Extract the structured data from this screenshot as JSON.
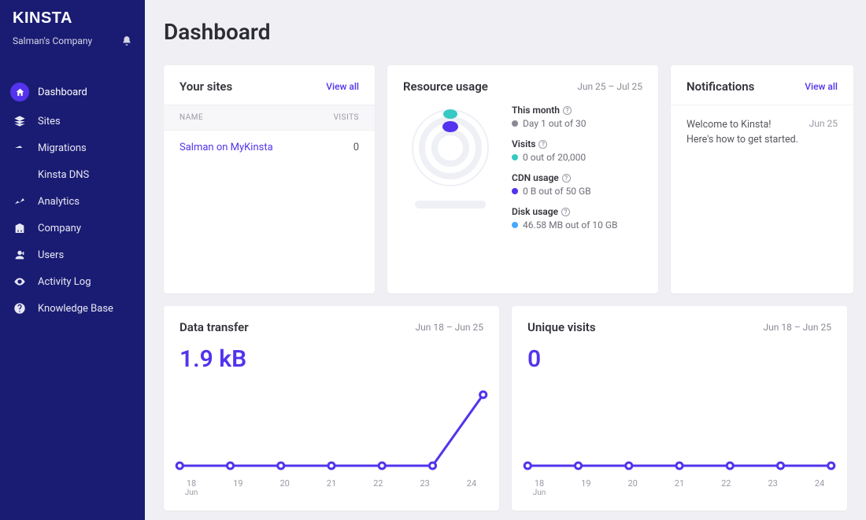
{
  "brand": "KINSTA",
  "company_name": "Salman's Company",
  "page_title": "Dashboard",
  "viewall_label": "View all",
  "nav": [
    {
      "label": "Dashboard"
    },
    {
      "label": "Sites"
    },
    {
      "label": "Migrations"
    },
    {
      "label": "Kinsta DNS"
    },
    {
      "label": "Analytics"
    },
    {
      "label": "Company"
    },
    {
      "label": "Users"
    },
    {
      "label": "Activity Log"
    },
    {
      "label": "Knowledge Base"
    }
  ],
  "sites": {
    "title": "Your sites",
    "col_name": "NAME",
    "col_visits": "VISITS",
    "rows": [
      {
        "name": "Salman on MyKinsta",
        "visits": "0"
      }
    ]
  },
  "usage": {
    "title": "Resource usage",
    "range": "Jun 25 – Jul 25",
    "month_label": "This month",
    "month_value": "Day 1 out of 30",
    "visits_label": "Visits",
    "visits_value": "0 out of 20,000",
    "cdn_label": "CDN usage",
    "cdn_value": "0 B out of 50 GB",
    "disk_label": "Disk usage",
    "disk_value": "46.58 MB out of 10 GB",
    "colors": {
      "month": "#8a8a95",
      "visits": "#37c9c3",
      "cdn": "#5333ed",
      "disk": "#4aa8ff"
    }
  },
  "notifications": {
    "title": "Notifications",
    "items": [
      {
        "msg": "Welcome to Kinsta! Here's how to get started.",
        "date": "Jun 25"
      }
    ]
  },
  "transfer": {
    "title": "Data transfer",
    "range": "Jun 18 – Jun 25",
    "value": "1.9 kB"
  },
  "visits": {
    "title": "Unique visits",
    "range": "Jun 18 – Jun 25",
    "value": "0"
  },
  "chart_data": [
    {
      "type": "line",
      "title": "Data transfer",
      "x": [
        "18",
        "19",
        "20",
        "21",
        "22",
        "23",
        "24"
      ],
      "x_month": "Jun",
      "values": [
        0,
        0,
        0,
        0,
        0,
        0,
        1.9
      ],
      "ylabel": "kB",
      "ylim": [
        0,
        2
      ]
    },
    {
      "type": "line",
      "title": "Unique visits",
      "x": [
        "18",
        "19",
        "20",
        "21",
        "22",
        "23",
        "24"
      ],
      "x_month": "Jun",
      "values": [
        0,
        0,
        0,
        0,
        0,
        0,
        0
      ],
      "ylabel": "visits",
      "ylim": [
        0,
        1
      ]
    }
  ]
}
